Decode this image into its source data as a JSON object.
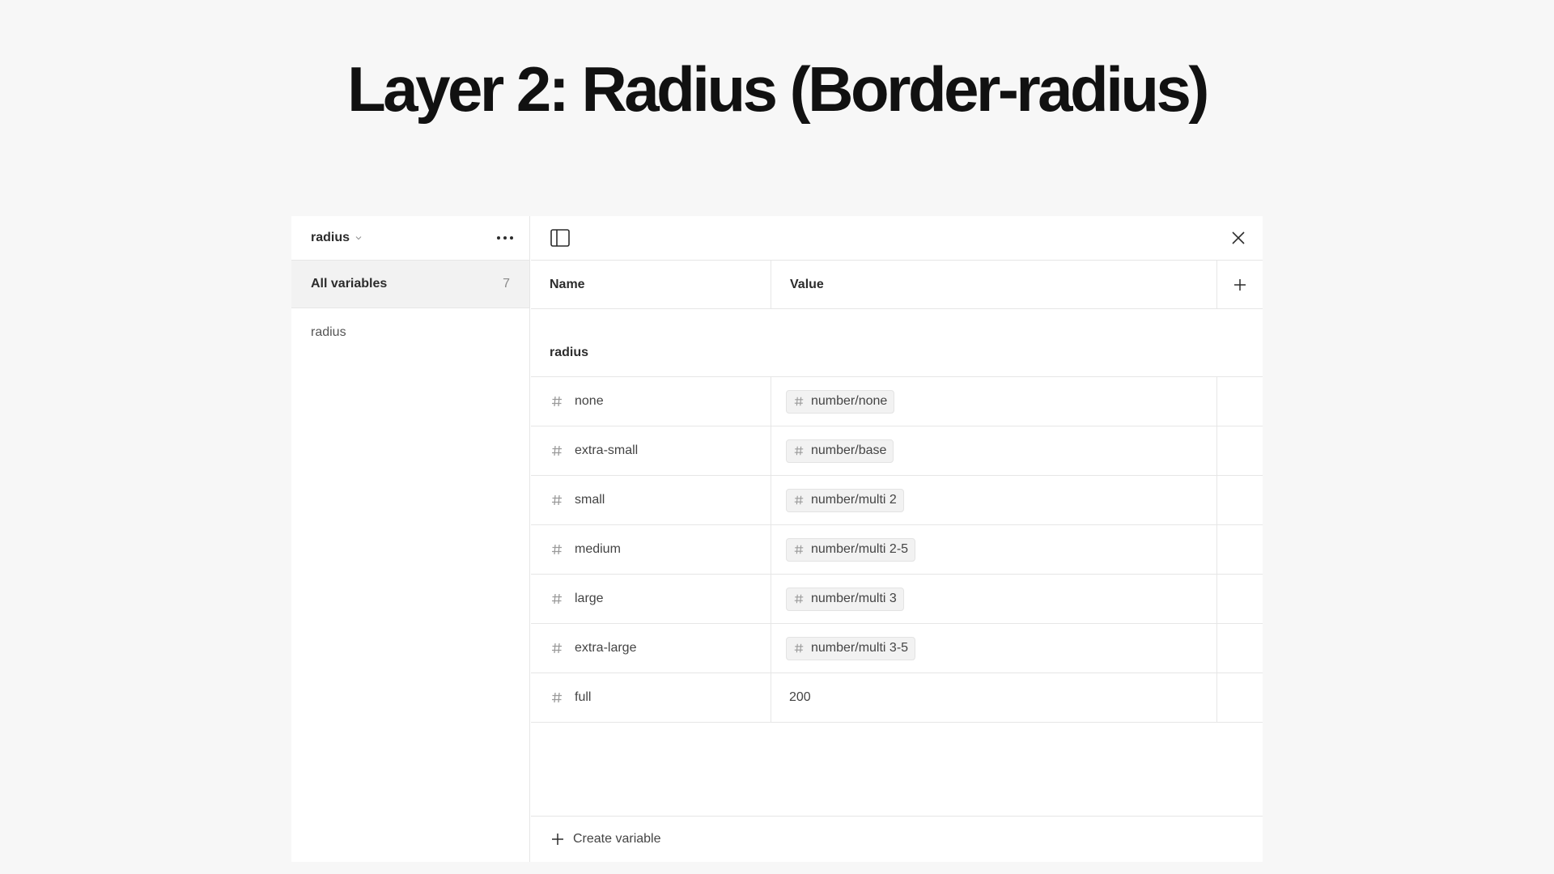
{
  "page": {
    "title": "Layer 2: Radius (Border-radius)"
  },
  "sidebar": {
    "collection": "radius",
    "all_variables": {
      "label": "All variables",
      "count": "7"
    },
    "groups": [
      {
        "label": "radius"
      }
    ]
  },
  "table": {
    "headers": {
      "name": "Name",
      "value": "Value"
    },
    "group_label": "radius",
    "rows": [
      {
        "name": "none",
        "value": "number/none",
        "alias": true
      },
      {
        "name": "extra-small",
        "value": "number/base",
        "alias": true
      },
      {
        "name": "small",
        "value": "number/multi 2",
        "alias": true
      },
      {
        "name": "medium",
        "value": "number/multi 2-5",
        "alias": true
      },
      {
        "name": "large",
        "value": "number/multi 3",
        "alias": true
      },
      {
        "name": "extra-large",
        "value": "number/multi 3-5",
        "alias": true
      },
      {
        "name": "full",
        "value": "200",
        "alias": false
      }
    ],
    "create_label": "Create variable"
  },
  "icons": {
    "collection_chevron": "chevron-down-icon",
    "more": "more-horizontal-icon",
    "sidebar_toggle": "sidebar-toggle-icon",
    "close": "close-icon",
    "add_column": "plus-icon",
    "variable_type": "number-hash-icon",
    "create": "plus-icon"
  }
}
